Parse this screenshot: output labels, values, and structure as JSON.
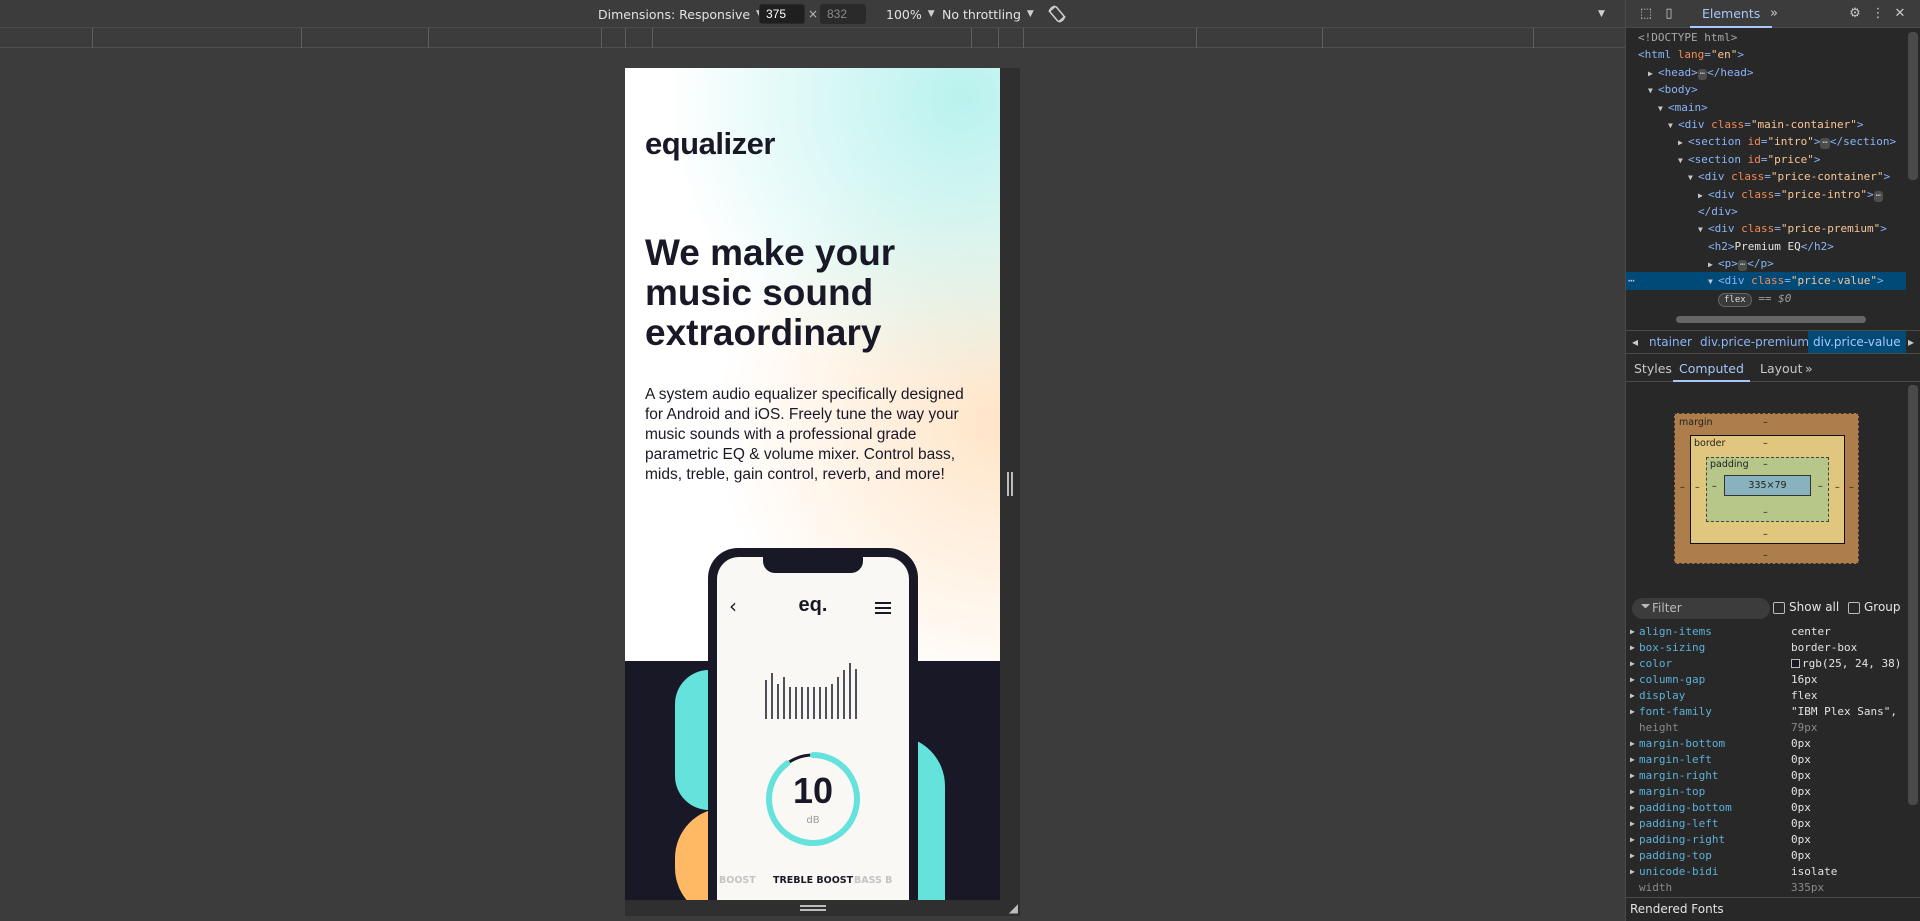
{
  "toolbar": {
    "dimensions_label": "Dimensions: Responsive",
    "width": "375",
    "times": "×",
    "height": "832",
    "zoom": "100%",
    "throttling": "No throttling"
  },
  "page": {
    "logo": "equalizer",
    "headline": "We make your music sound extraordinary",
    "description": "A system audio equalizer specifically designed for Android and iOS. Freely tune the way your music sounds with a professional grade parametric EQ & volume mixer. Control bass, mids, treble, gain control, reverb, and more!",
    "app": {
      "back_icon": "‹",
      "title": "eq.",
      "gauge_value": "10",
      "gauge_unit": "dB",
      "gauge_fraction": 0.9,
      "modes": [
        "BOOST",
        "TREBLE BOOST",
        "BASS B"
      ],
      "bar_levels": [
        0.55,
        0.65,
        0.5,
        0.6,
        0.45,
        0.45,
        0.45,
        0.45,
        0.45,
        0.45,
        0.45,
        0.5,
        0.6,
        0.7,
        0.8,
        0.72
      ]
    },
    "colors": {
      "dark": "#191826",
      "teal": "#66e2dc",
      "orange": "#ffb964"
    }
  },
  "devtools": {
    "tab_elements": "Elements",
    "more_tabs": "»",
    "dom": [
      {
        "doctype": "<!DOCTYPE html>"
      },
      {
        "open": "html",
        "attrs": [
          [
            "lang",
            "en"
          ]
        ]
      },
      {
        "tri": "▶",
        "open": "head",
        "collapsed": true,
        "close": "head"
      },
      {
        "tri": "▼",
        "open": "body"
      },
      {
        "tri": "▼",
        "open": "main"
      },
      {
        "tri": "▼",
        "open": "div",
        "attrs": [
          [
            "class",
            "main-container"
          ]
        ]
      },
      {
        "tri": "▶",
        "open": "section",
        "attrs": [
          [
            "id",
            "intro"
          ]
        ],
        "collapsed": true,
        "close": "section"
      },
      {
        "tri": "▼",
        "open": "section",
        "attrs": [
          [
            "id",
            "price"
          ]
        ]
      },
      {
        "tri": "▼",
        "open": "div",
        "attrs": [
          [
            "class",
            "price-container"
          ]
        ]
      },
      {
        "tri": "▶",
        "open": "div",
        "attrs": [
          [
            "class",
            "price-intro"
          ]
        ],
        "collapsed": true
      },
      {
        "close": "div"
      },
      {
        "tri": "▼",
        "open": "div",
        "attrs": [
          [
            "class",
            "price-premium"
          ]
        ]
      },
      {
        "open": "h2",
        "text": "Premium EQ",
        "close": "h2"
      },
      {
        "tri": "▶",
        "open": "p",
        "collapsed": true,
        "close": "p"
      },
      {
        "tri": "▼",
        "open": "div",
        "attrs": [
          [
            "class",
            "price-value"
          ]
        ],
        "selected": true
      },
      {
        "badge": "flex",
        "eq": "== $0"
      }
    ],
    "breadcrumbs": [
      "ntainer",
      "div.price-premium",
      "div.price-value"
    ],
    "sub_tabs": [
      "Styles",
      "Computed",
      "Layout",
      "»"
    ],
    "box_model": {
      "margin": "margin",
      "border": "border",
      "padding": "padding",
      "content": "335×79",
      "dash": "–"
    },
    "filter_placeholder": "Filter",
    "show_all": "Show all",
    "group": "Group",
    "computed": [
      {
        "name": "align-items",
        "value": "center"
      },
      {
        "name": "box-sizing",
        "value": "border-box"
      },
      {
        "name": "color",
        "value": "rgb(25, 24, 38)",
        "swatch": true
      },
      {
        "name": "column-gap",
        "value": "16px"
      },
      {
        "name": "display",
        "value": "flex"
      },
      {
        "name": "font-family",
        "value": "\"IBM Plex Sans\","
      },
      {
        "name": "height",
        "value": "79px",
        "muted": true
      },
      {
        "name": "margin-bottom",
        "value": "0px"
      },
      {
        "name": "margin-left",
        "value": "0px"
      },
      {
        "name": "margin-right",
        "value": "0px"
      },
      {
        "name": "margin-top",
        "value": "0px"
      },
      {
        "name": "padding-bottom",
        "value": "0px"
      },
      {
        "name": "padding-left",
        "value": "0px"
      },
      {
        "name": "padding-right",
        "value": "0px"
      },
      {
        "name": "padding-top",
        "value": "0px"
      },
      {
        "name": "unicode-bidi",
        "value": "isolate"
      },
      {
        "name": "width",
        "value": "335px",
        "muted": true
      }
    ],
    "rendered_fonts": "Rendered Fonts"
  }
}
